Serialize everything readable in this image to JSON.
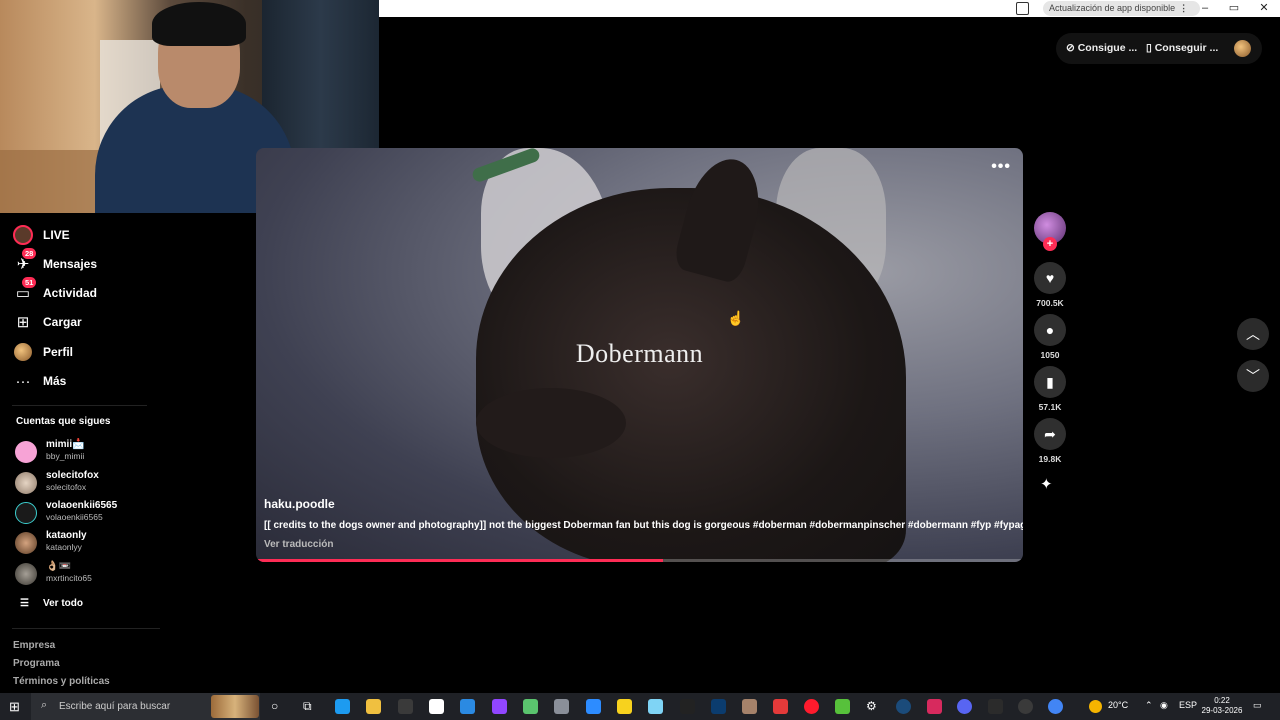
{
  "titlebar": {
    "update_label": "Actualización de app disponible",
    "update_dots": "⋮",
    "minimize": "–",
    "maximize": "▭",
    "close": "✕"
  },
  "top_actions": {
    "coins_label": "Consigue ...",
    "app_label": "Conseguir ..."
  },
  "sidebar": {
    "items": [
      {
        "label": "LIVE",
        "icon": "live-icon"
      },
      {
        "label": "Mensajes",
        "icon": "messages-icon",
        "badge": "28"
      },
      {
        "label": "Actividad",
        "icon": "activity-icon",
        "badge": "51"
      },
      {
        "label": "Cargar",
        "icon": "upload-icon"
      },
      {
        "label": "Perfil",
        "icon": "profile-icon"
      },
      {
        "label": "Más",
        "icon": "more-icon"
      }
    ],
    "following_title": "Cuentas que sigues",
    "following": [
      {
        "name": "mimii📩",
        "handle": "bby_mimii",
        "color": "#f7a3d6"
      },
      {
        "name": "solecitofox",
        "handle": "solecitofox",
        "color": "#c9b5a3"
      },
      {
        "name": "volaoenkii6565",
        "handle": "volaoenkii6565",
        "color": "#1a1a1a"
      },
      {
        "name": "kataonly",
        "handle": "kataonlyy",
        "color": "#a87b58"
      },
      {
        "name": "👌🏼📼",
        "handle": "mxrtincito65",
        "color": "#6e6a63"
      }
    ],
    "see_all": "Ver todo",
    "footer": [
      "Empresa",
      "Programa",
      "Términos y políticas"
    ]
  },
  "video": {
    "overlay_title": "Dobermann",
    "more": "•••",
    "username": "haku.poodle",
    "description": "[[ credits to the dogs owner and photography]] not the biggest Doberman fan but this dog is gorgeous #doberman #dobermanpinscher #dobermann #fyp #fypage",
    "translate": "Ver traducción",
    "progress": 0.53
  },
  "actions": {
    "follow_plus": "+",
    "likes": "700.5K",
    "comments": "1050",
    "saves": "57.1K",
    "shares": "19.8K"
  },
  "taskbar": {
    "search_placeholder": "Escribe aquí para buscar",
    "weather": "20°C",
    "language": "ESP",
    "time": "0:22",
    "date": "29-03-2026"
  },
  "colors": {
    "accent": "#fe2c55",
    "background": "#000000"
  }
}
